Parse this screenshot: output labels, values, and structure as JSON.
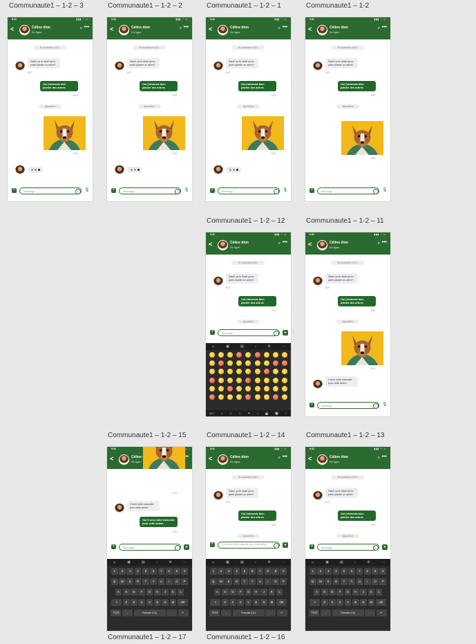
{
  "labels": {
    "f3": "Communaute1 – 1-2 – 3",
    "f2": "Communaute1 – 1-2 – 2",
    "f1": "Communaute1 – 1-2 – 1",
    "f0": "Communaute1 – 1-2",
    "f12": "Communaute1 – 1-2 – 12",
    "f11": "Communaute1 – 1-2 – 11",
    "f15": "Communaute1 – 1-2 – 15",
    "f14": "Communaute1 – 1-2 – 14",
    "f13": "Communaute1 – 1-2 – 13",
    "f17": "Communaute1 – 1-2 – 17",
    "f16": "Communaute1 – 1-2 – 16"
  },
  "chat": {
    "status_time": "9:41",
    "status_icons": "▮▮▮ ◠ ▭",
    "back_icon": "<",
    "contact_name": "Céline dion",
    "contact_status": "En ligne",
    "search_icon": "⌕",
    "more_icon": "•••",
    "date_label": "Hi novembre 2021",
    "today_label": "Ajourd'hui",
    "msg_in_1": "Salut! ça te dirait qu'on parte planter un arbre?",
    "time_in_1": "8:07",
    "msg_out_1": "Oui j'aimerais bien planter des arbres",
    "time_out_1": "8:13",
    "time_photo": "8:13",
    "time_photo_alt": "8:15",
    "msg_in_2": "Il sera notre mascotte pour cette action",
    "msg_out_2": "Oui il sera notre mascotte pour cette action",
    "time_out_2": "8:15",
    "input_placeholder": "Message",
    "input_typed": "Oui il sera notre mascotte pour cette action",
    "plus_icon": "+",
    "mic_icon": "🎙",
    "send_icon": "➤",
    "emoji_icon": "☺"
  },
  "keyboard": {
    "toolbar": [
      "☺",
      "▣",
      "▤",
      "↓",
      "⚙",
      "···"
    ],
    "row_numbers": [
      "1",
      "2",
      "3",
      "4",
      "5",
      "6",
      "7",
      "8",
      "9",
      "0"
    ],
    "row_top": [
      "Q",
      "W",
      "E",
      "R",
      "T",
      "Y",
      "U",
      "I",
      "O",
      "P"
    ],
    "row_mid": [
      "A",
      "S",
      "D",
      "F",
      "G",
      "H",
      "J",
      "K",
      "L"
    ],
    "row_bot": [
      "⇧",
      "Z",
      "X",
      "C",
      "V",
      "B",
      "N",
      "M",
      "⌫"
    ],
    "row_space": [
      "?123",
      ",",
      "Français (CA)",
      ".",
      "↵"
    ],
    "emoji_bar": [
      "ABC",
      "⌕",
      "◷",
      "☺",
      "⚑",
      "⌂",
      "☕",
      "⚽",
      "⚐"
    ]
  },
  "colors": {
    "header_green": "#2c6b2f",
    "bubble_out": "#23682a",
    "bubble_in": "#eeeef2",
    "photo_bg": "#f2b81c",
    "keyboard_bg": "#2b2b2b"
  }
}
